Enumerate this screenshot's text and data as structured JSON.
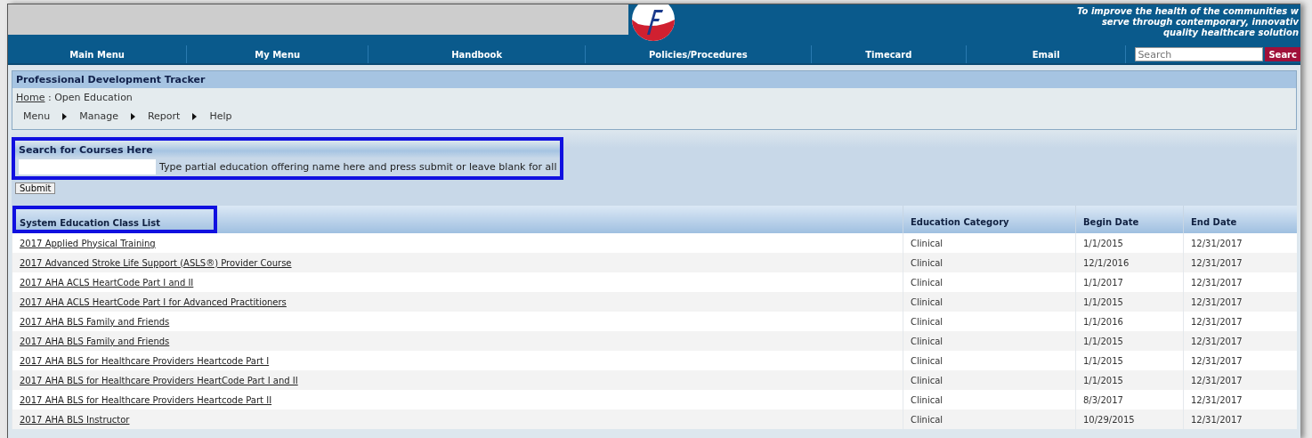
{
  "header": {
    "tagline": [
      "To improve the health of the communities w",
      "serve through contemporary, innovativ",
      "quality healthcare solution"
    ]
  },
  "nav": {
    "items": [
      "Main Menu",
      "My Menu",
      "Handbook",
      "Policies/Procedures",
      "Timecard",
      "Email"
    ],
    "search": {
      "placeholder": "Search"
    },
    "search_button": "Searc"
  },
  "app": {
    "title": "Professional Development Tracker",
    "breadcrumb": {
      "link": "Home",
      "current": ": Open Education"
    },
    "menu": [
      "Menu",
      "Manage",
      "Report",
      "Help"
    ]
  },
  "search": {
    "heading": "Search for Courses Here",
    "hint": "Type partial education offering name here and press submit or leave blank for all",
    "submit": "Submit"
  },
  "table": {
    "columns": [
      "System Education Class List",
      "Education Category",
      "Begin Date",
      "End Date"
    ],
    "rows": [
      {
        "name": "2017 Applied Physical Training",
        "category": "Clinical",
        "begin": "1/1/2015",
        "end": "12/31/2017"
      },
      {
        "name": "2017 Advanced Stroke Life Support (ASLS®) Provider Course",
        "category": "Clinical",
        "begin": "12/1/2016",
        "end": "12/31/2017"
      },
      {
        "name": "2017 AHA ACLS HeartCode Part I and II",
        "category": "Clinical",
        "begin": "1/1/2017",
        "end": "12/31/2017"
      },
      {
        "name": "2017 AHA ACLS HeartCode Part I for Advanced Practitioners",
        "category": "Clinical",
        "begin": "1/1/2015",
        "end": "12/31/2017"
      },
      {
        "name": "2017 AHA BLS Family and Friends",
        "category": "Clinical",
        "begin": "1/1/2016",
        "end": "12/31/2017"
      },
      {
        "name": "2017 AHA BLS Family and Friends",
        "category": "Clinical",
        "begin": "1/1/2015",
        "end": "12/31/2017"
      },
      {
        "name": "2017 AHA BLS for Healthcare Providers Heartcode Part I",
        "category": "Clinical",
        "begin": "1/1/2015",
        "end": "12/31/2017"
      },
      {
        "name": "2017 AHA BLS for Healthcare Providers HeartCode Part I and II",
        "category": "Clinical",
        "begin": "1/1/2015",
        "end": "12/31/2017"
      },
      {
        "name": "2017 AHA BLS for Healthcare Providers Heartcode Part II",
        "category": "Clinical",
        "begin": "8/3/2017",
        "end": "12/31/2017"
      },
      {
        "name": "2017 AHA BLS Instructor",
        "category": "Clinical",
        "begin": "10/29/2015",
        "end": "12/31/2017"
      }
    ]
  }
}
